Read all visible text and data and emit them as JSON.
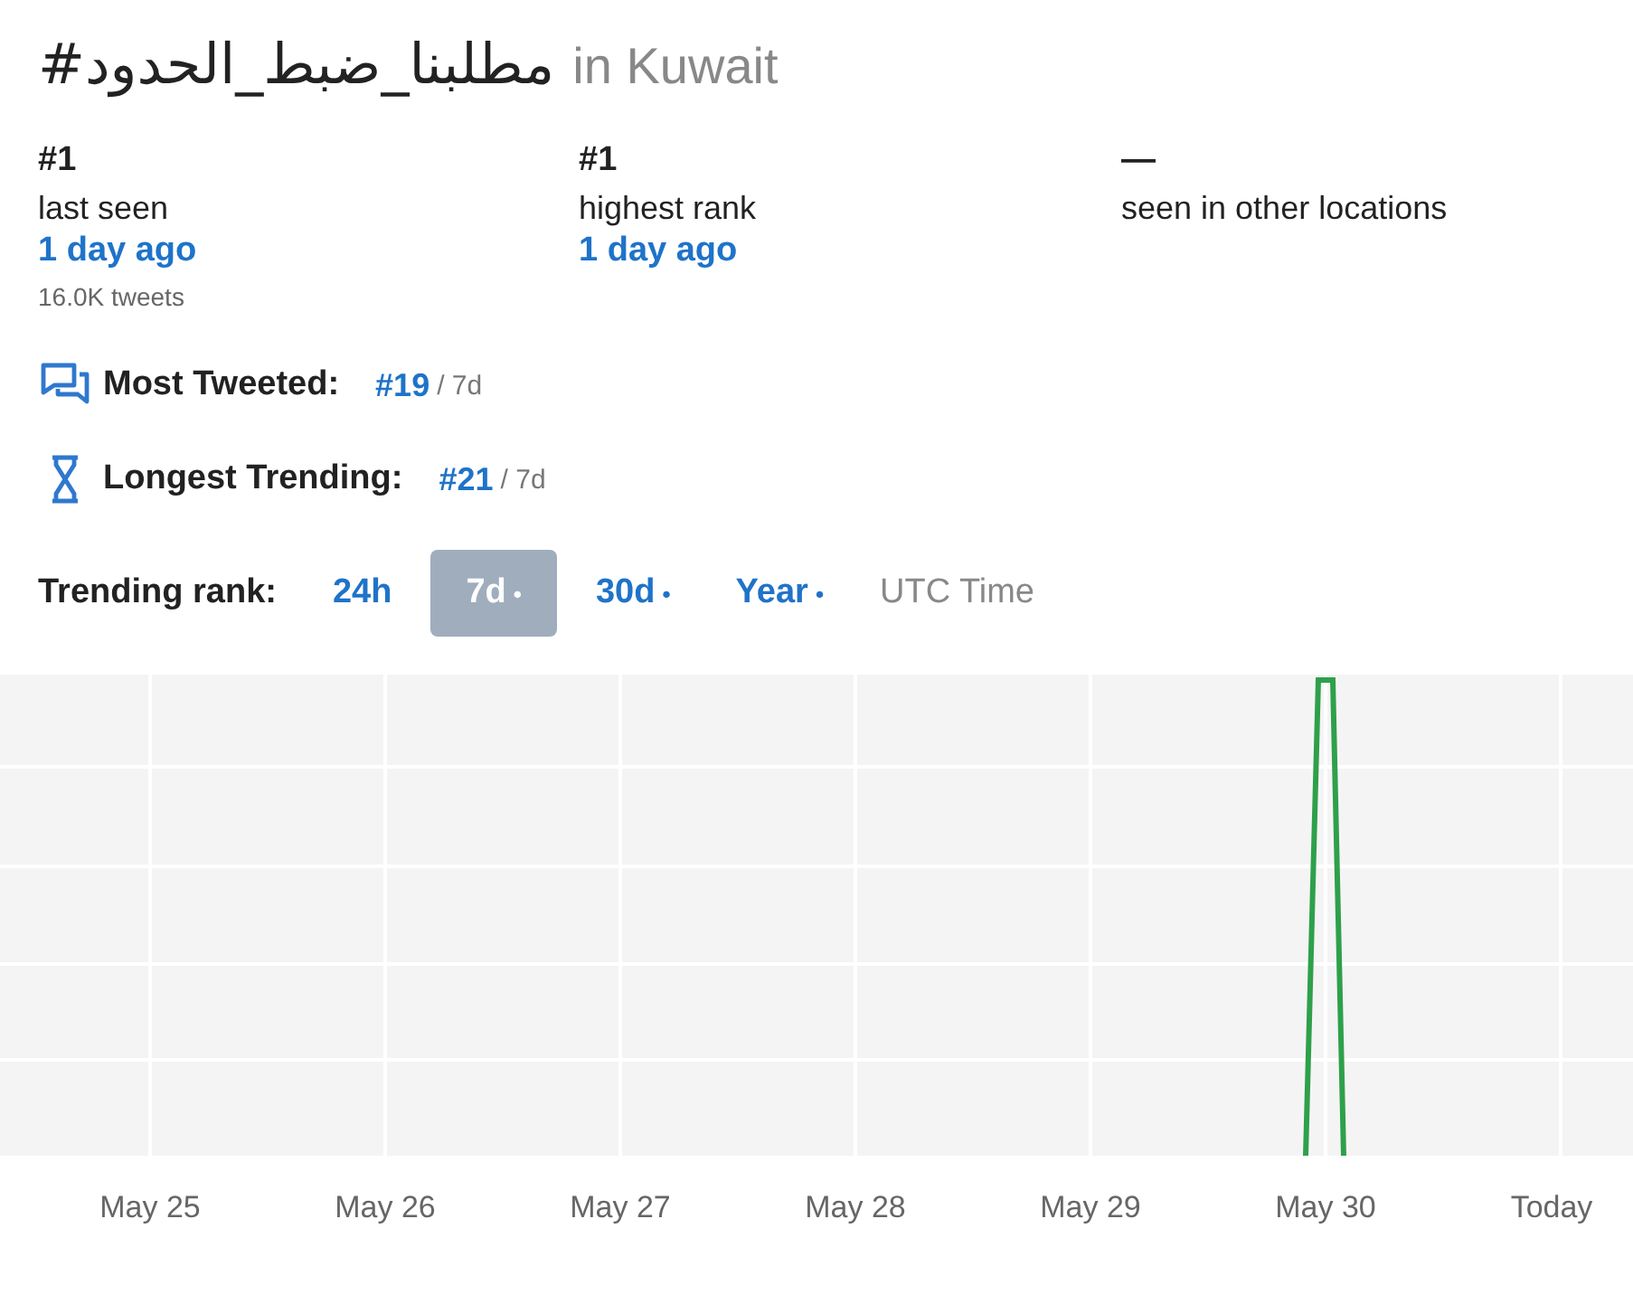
{
  "title": {
    "hashtag": "#مطلبنا_ضبط_الحدود",
    "location": "in Kuwait"
  },
  "stats": [
    {
      "rank": "#1",
      "label": "last seen",
      "time": "1 day ago",
      "note": "16.0K tweets"
    },
    {
      "rank": "#1",
      "label": "highest rank",
      "time": "1 day ago"
    },
    {
      "rank": "—",
      "label": "seen in other locations"
    }
  ],
  "records": [
    {
      "kind": "tweets",
      "label": "Most Tweeted:",
      "rank": "#19",
      "period": "/ 7d"
    },
    {
      "kind": "duration",
      "label": "Longest Trending:",
      "rank": "#21",
      "period": "/ 7d"
    }
  ],
  "trending": {
    "label": "Trending rank:",
    "ranges": [
      {
        "label": "24h",
        "selected": false
      },
      {
        "label": "7d",
        "dot": "•",
        "selected": true
      },
      {
        "label": "30d",
        "dot": "•",
        "selected": false
      },
      {
        "label": "Year",
        "dot": "•",
        "selected": false
      }
    ],
    "utc_toggle": {
      "label": "UTC Time",
      "on": false
    }
  },
  "chart": {
    "x_labels": [
      "May 25",
      "May 26",
      "May 27",
      "May 28",
      "May 29",
      "May 30",
      "Today"
    ]
  }
}
